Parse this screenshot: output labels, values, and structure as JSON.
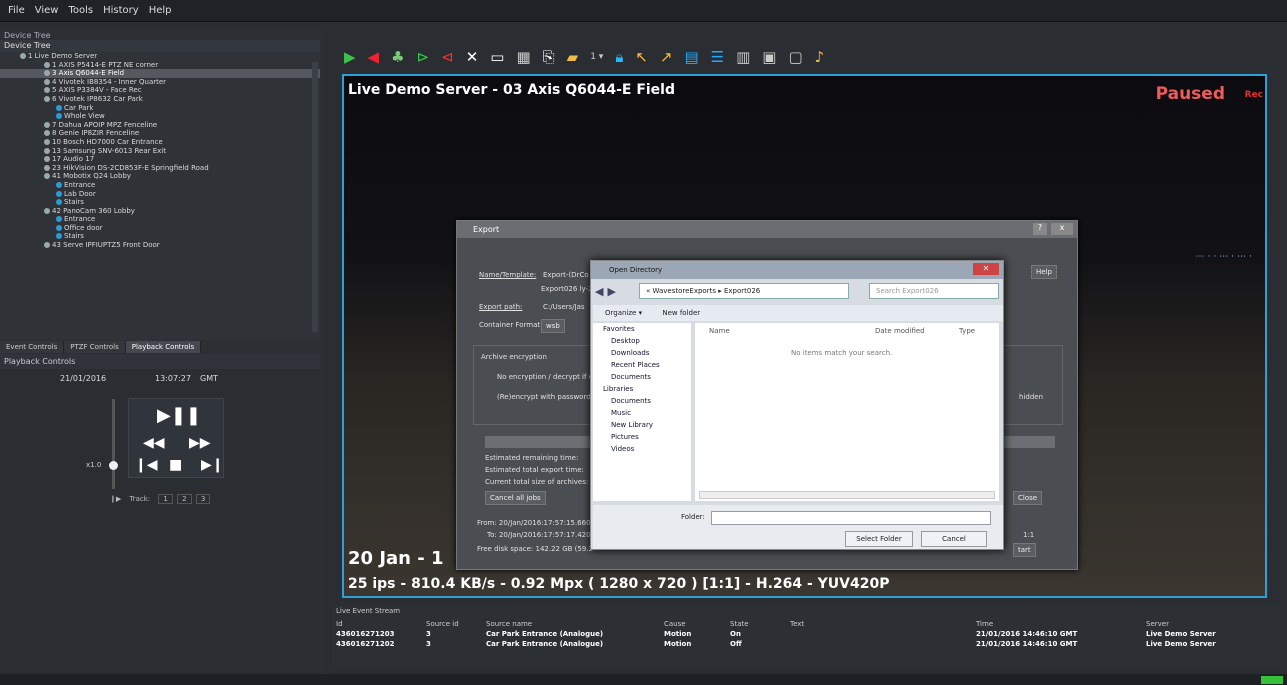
{
  "menu": [
    "File",
    "View",
    "Tools",
    "History",
    "Help"
  ],
  "left": {
    "device_tree_header": "Device Tree",
    "device_tree_title": "Device Tree",
    "tree_items": [
      {
        "label": "1 Live Demo Server",
        "type": "server"
      },
      {
        "label": "1 AXIS P5414-E PTZ NE corner",
        "type": "cam"
      },
      {
        "label": "3 Axis Q6044-E Field",
        "type": "cam",
        "selected": true
      },
      {
        "label": "4 Vivotek IB8354 - Inner Quarter",
        "type": "cam"
      },
      {
        "label": "5 AXIS P3384V - Face Rec",
        "type": "cam"
      },
      {
        "label": "6 Vivotek IP8632 Car Park",
        "type": "cam"
      },
      {
        "label": "Car Park",
        "type": "sub"
      },
      {
        "label": "Whole View",
        "type": "sub"
      },
      {
        "label": "7 Dahua APOIP MPZ Fenceline",
        "type": "cam"
      },
      {
        "label": "8 Genie IP8ZIR Fenceline",
        "type": "cam"
      },
      {
        "label": "10 Bosch HD7000 Car Entrance",
        "type": "cam"
      },
      {
        "label": "13 Samsung SNV-6013 Rear Exit",
        "type": "cam"
      },
      {
        "label": "17 Audio 17",
        "type": "cam"
      },
      {
        "label": "23 HikVision DS-2CD853F-E Springfield Road",
        "type": "cam"
      },
      {
        "label": "41 Mobotix Q24 Lobby",
        "type": "cam"
      },
      {
        "label": "Entrance",
        "type": "sub"
      },
      {
        "label": "Lab Door",
        "type": "sub"
      },
      {
        "label": "Stairs",
        "type": "sub"
      },
      {
        "label": "42 PanoCam 360 Lobby",
        "type": "cam"
      },
      {
        "label": "Entrance",
        "type": "sub"
      },
      {
        "label": "Office door",
        "type": "sub"
      },
      {
        "label": "Stairs",
        "type": "sub"
      },
      {
        "label": "43 Serve IPFIUPTZ5 Front Door",
        "type": "cam"
      }
    ],
    "tabs": [
      "Event Controls",
      "PTZF Controls",
      "Playback Controls"
    ],
    "playback": {
      "header": "Playback Controls",
      "date": "21/01/2016",
      "time": "13:07:27",
      "tz": "GMT",
      "speed": "x1.0",
      "track_label": "Track:",
      "tracks": [
        "1",
        "2",
        "3"
      ]
    }
  },
  "video": {
    "title": "Live Demo Server - 03 Axis Q6044-E Field",
    "paused": "Paused",
    "rec": "Rec",
    "date": "20 Jan - 1",
    "info": "25 ips - 810.4 KB/s - 0.92 Mpx ( 1280 x 720 ) [1:1] - H.264 - YUV420P"
  },
  "export": {
    "title": "Export",
    "name_template_label": "Name/Template:",
    "name_template_value": "Export-(DrCo",
    "export_sub": "Export026 ly-2",
    "export_path_label": "Export path:",
    "export_path_value": "C:/Users/Jas",
    "container_label": "Container Format:",
    "container_value": "wsb",
    "archive_enc": "Archive encryption",
    "no_enc": "No encryption / decrypt if en",
    "reenc": "(Re)encrypt with password:",
    "hidden": "hidden",
    "est_remaining": "Estimated remaining time:",
    "est_total": "Estimated total export time:",
    "cur_size": "Current total size of archives:",
    "cancel_all": "Cancel all jobs",
    "close": "Close",
    "from": "From: 20/Jan/2016:17:57:15.660",
    "to": "To: 20/Jan/2016:17:57:17.420",
    "free_disk": "Free disk space: 142.22 GB (59.2",
    "help": "Help",
    "start": "tart",
    "val_1": "1:1"
  },
  "dialog": {
    "title": "Open Directory",
    "path": "«  WavestoreExports  ▸  Export026",
    "search": "Search Export026",
    "organize": "Organize ▾",
    "new_folder": "New folder",
    "nav": [
      "Favorites",
      "Desktop",
      "Downloads",
      "Recent Places",
      "Documents",
      "",
      "Libraries",
      "Documents",
      "Music",
      "New Library",
      "Pictures",
      "Videos"
    ],
    "col_name": "Name",
    "col_date": "Date modified",
    "col_type": "Type",
    "empty": "No items match your search.",
    "folder_label": "Folder:",
    "select": "Select Folder",
    "cancel": "Cancel"
  },
  "events": {
    "title": "Live Event Stream",
    "cols": [
      "Id",
      "Source id",
      "Source name",
      "Cause",
      "State",
      "Text",
      "Time",
      "Server"
    ],
    "rows": [
      [
        "436016271203",
        "3",
        "Car Park Entrance (Analogue)",
        "Motion",
        "On",
        "",
        "21/01/2016 14:46:10 GMT",
        "Live Demo Server"
      ],
      [
        "436016271202",
        "3",
        "Car Park Entrance (Analogue)",
        "Motion",
        "Off",
        "",
        "21/01/2016 14:46:10 GMT",
        "Live Demo Server"
      ]
    ]
  }
}
